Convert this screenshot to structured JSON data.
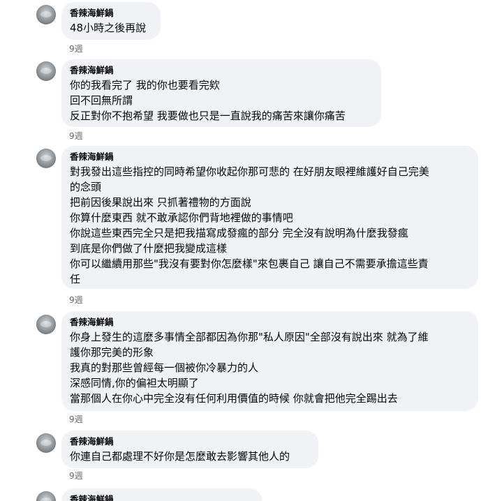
{
  "comments": [
    {
      "author": "香辣海鮮鍋",
      "lines": [
        "48小時之後再說"
      ],
      "time": "9週"
    },
    {
      "author": "香辣海鮮鍋",
      "lines": [
        "你的我看完了 我的你也要看完欸",
        "回不回無所謂",
        "反正對你不抱希望 我要做也只是一直說我的痛苦來讓你痛苦"
      ],
      "time": "9週"
    },
    {
      "author": "香辣海鮮鍋",
      "lines": [
        "對我發出這些指控的同時希望你收起你那可悲的 在好朋友眼裡維護好自己完美",
        "的念頭",
        "把前因後果說出來 只抓著禮物的方面說",
        "你算什麼東西 就不敢承認你們背地裡做的事情吧",
        "你說這些東西完全只是把我描寫成發瘋的部分 完全沒有說明為什麼我發瘋",
        "到底是你們做了什麼把我變成這樣",
        "你可以繼續用那些\"我沒有要對你怎麼樣\"來包裹自己 讓自己不需要承擔這些責",
        "任"
      ],
      "time": "9週"
    },
    {
      "author": "香辣海鮮鍋",
      "lines": [
        "你身上發生的這麼多事情全部都因為你那\"私人原因\"全部沒有說出來 就為了維",
        "護你那完美的形象",
        "我真的對那些曾經每一個被你冷暴力的人",
        "深感同情,你的偏袒太明顯了",
        "當那個人在你心中完全沒有任何利用價值的時候 你就會把他完全踢出去"
      ],
      "time": "9週"
    },
    {
      "author": "香辣海鮮鍋",
      "lines": [
        "你連自己都處理不好你是怎麼敢去影響其他人的"
      ],
      "time": "9週"
    },
    {
      "author": "香辣海鮮鍋",
      "lines": [],
      "time": ""
    }
  ]
}
